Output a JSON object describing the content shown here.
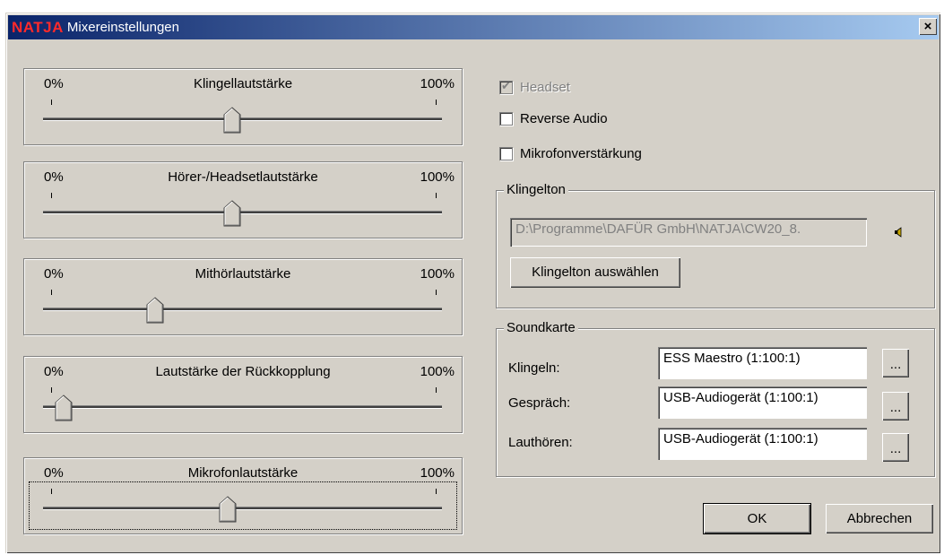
{
  "title": {
    "brand": "NATJA",
    "text": "Mixereinstellungen",
    "close": "×"
  },
  "sliders": [
    {
      "label": "Klingellautstärke",
      "min": "0%",
      "max": "100%",
      "value": 0.47
    },
    {
      "label": "Hörer-/Headsetlautstärke",
      "min": "0%",
      "max": "100%",
      "value": 0.47
    },
    {
      "label": "Mithörlautstärke",
      "min": "0%",
      "max": "100%",
      "value": 0.27
    },
    {
      "label": "Lautstärke der Rückkopplung",
      "min": "0%",
      "max": "100%",
      "value": 0.03
    },
    {
      "label": "Mikrofonlautstärke",
      "min": "0%",
      "max": "100%",
      "value": 0.46
    }
  ],
  "checkboxes": {
    "headset": {
      "label": "Headset",
      "checked": true,
      "disabled": true
    },
    "reverse": {
      "label": "Reverse Audio",
      "checked": false
    },
    "mikro": {
      "label": "Mikrofonverstärkung",
      "checked": false
    }
  },
  "klingelton": {
    "legend": "Klingelton",
    "path": "D:\\Programme\\DAFÜR GmbH\\NATJA\\CW20_8.",
    "select_button": "Klingelton auswählen",
    "speaker_icon": "speaker-icon"
  },
  "soundkarte": {
    "legend": "Soundkarte",
    "rows": [
      {
        "label": "Klingeln:",
        "value": "ESS Maestro (1:100:1)",
        "button": "..."
      },
      {
        "label": "Gespräch:",
        "value": "USB-Audiogerät (1:100:1)",
        "button": "..."
      },
      {
        "label": "Lauthören:",
        "value": "USB-Audiogerät (1:100:1)",
        "button": "..."
      }
    ]
  },
  "buttons": {
    "ok": "OK",
    "cancel": "Abbrechen"
  },
  "colors": {
    "title_gradient_start": "#0a246a",
    "title_gradient_end": "#a6caf0",
    "brand": "#ff2a2a",
    "face": "#d4d0c8"
  }
}
